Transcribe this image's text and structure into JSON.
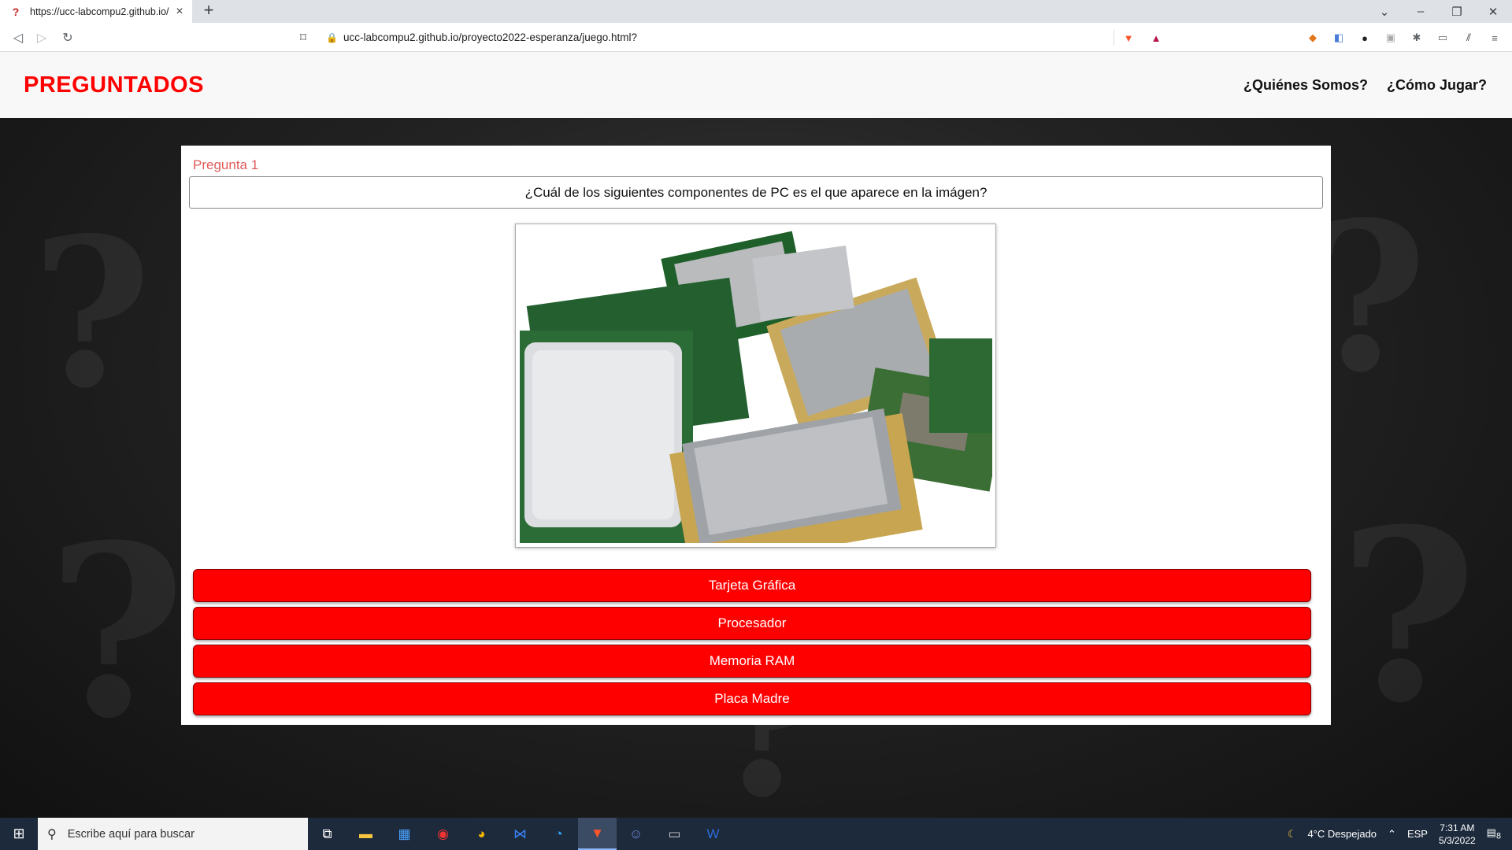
{
  "browser": {
    "tab_title": "https://ucc-labcompu2.github.io/",
    "url": "ucc-labcompu2.github.io/proyecto2022-esperanza/juego.html?"
  },
  "header": {
    "brand": "PREGUNTADOS",
    "nav": [
      "¿Quiénes Somos?",
      "¿Cómo Jugar?"
    ]
  },
  "quiz": {
    "question_number": "Pregunta 1",
    "question": "¿Cuál de los siguientes componentes de PC es el que aparece en la imágen?",
    "answers": [
      "Tarjeta Gráfica",
      "Procesador",
      "Memoria RAM",
      "Placa Madre"
    ],
    "accent_color": "#ff0000"
  },
  "taskbar": {
    "search_placeholder": "Escribe aquí para buscar",
    "weather": "4°C  Despejado",
    "language": "ESP",
    "time": "7:31 AM",
    "date": "5/3/2022",
    "notification_count": "8"
  }
}
